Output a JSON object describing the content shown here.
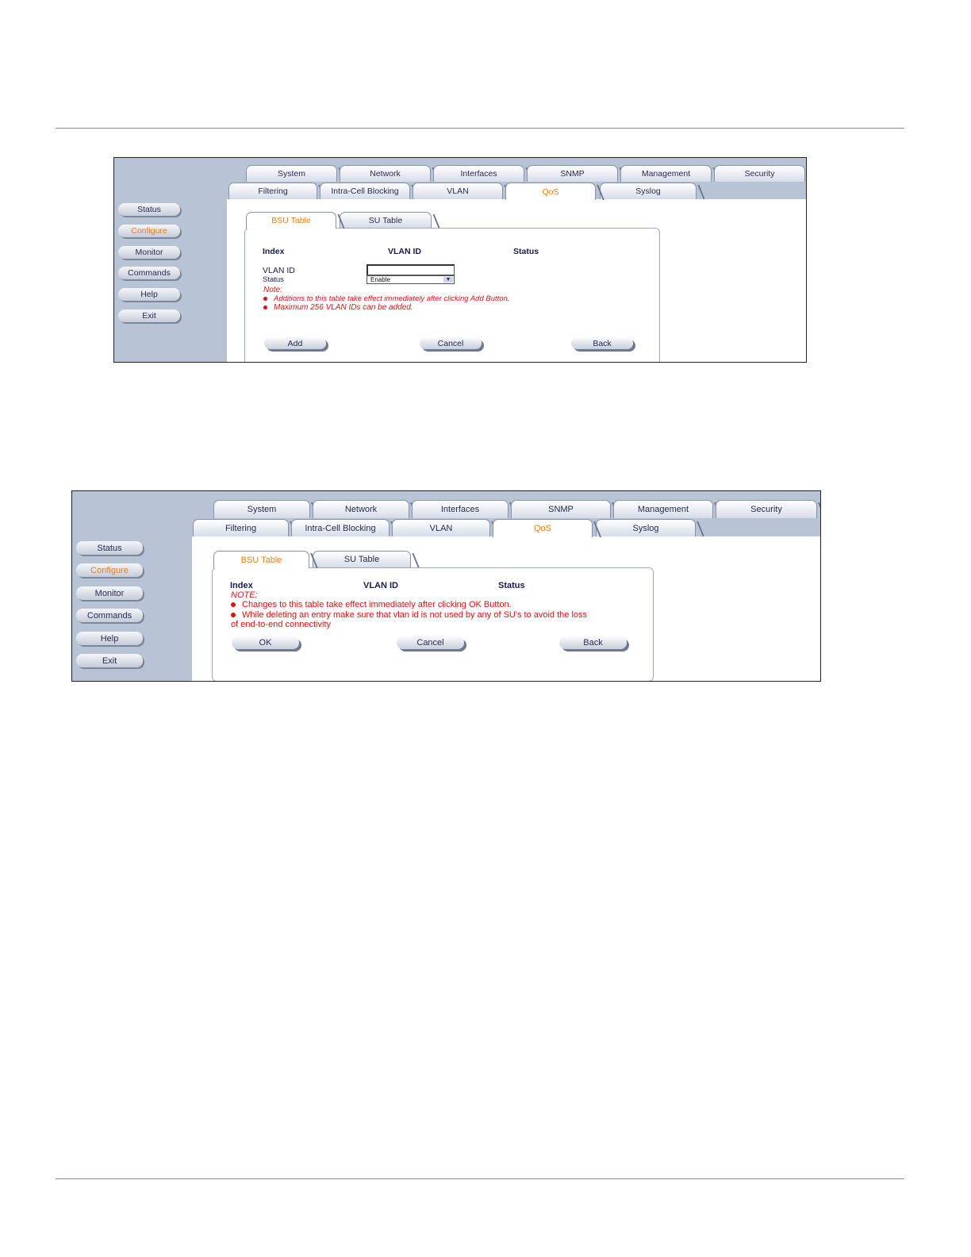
{
  "top_tabs": [
    "System",
    "Network",
    "Interfaces",
    "SNMP",
    "Management",
    "Security"
  ],
  "sub_tabs": [
    "Filtering",
    "Intra-Cell Blocking",
    "VLAN",
    "QoS",
    "Syslog"
  ],
  "side_nav": [
    "Status",
    "Configure",
    "Monitor",
    "Commands",
    "Help",
    "Exit"
  ],
  "table_tabs": [
    "BSU Table",
    "SU Table"
  ],
  "add_screen": {
    "headers": [
      "Index",
      "VLAN ID",
      "Status"
    ],
    "vlan_label": "VLAN ID",
    "vlan_value": "",
    "status_label": "Status",
    "status_value": "Enable",
    "note_label": "Note:",
    "notes": [
      "Additions to this table take effect immediately after clicking Add Button.",
      "Maximum 256 VLAN IDs can be added."
    ],
    "buttons": [
      "Add",
      "Cancel",
      "Back"
    ]
  },
  "edit_screen": {
    "headers": [
      "Index",
      "VLAN ID",
      "Status"
    ],
    "note_label": "NOTE:",
    "notes": [
      "Changes to this table take effect immediately after clicking OK Button.",
      "While deleting an entry make sure that vlan id is not used by any of SU's to avoid the loss"
    ],
    "note_continuation": "of end-to-end connectivity",
    "buttons": [
      "OK",
      "Cancel",
      "Back"
    ]
  },
  "colors": {
    "active_tab": "#f07b14",
    "note_red": "#e01010",
    "sidebar": "#b9c3d6"
  }
}
